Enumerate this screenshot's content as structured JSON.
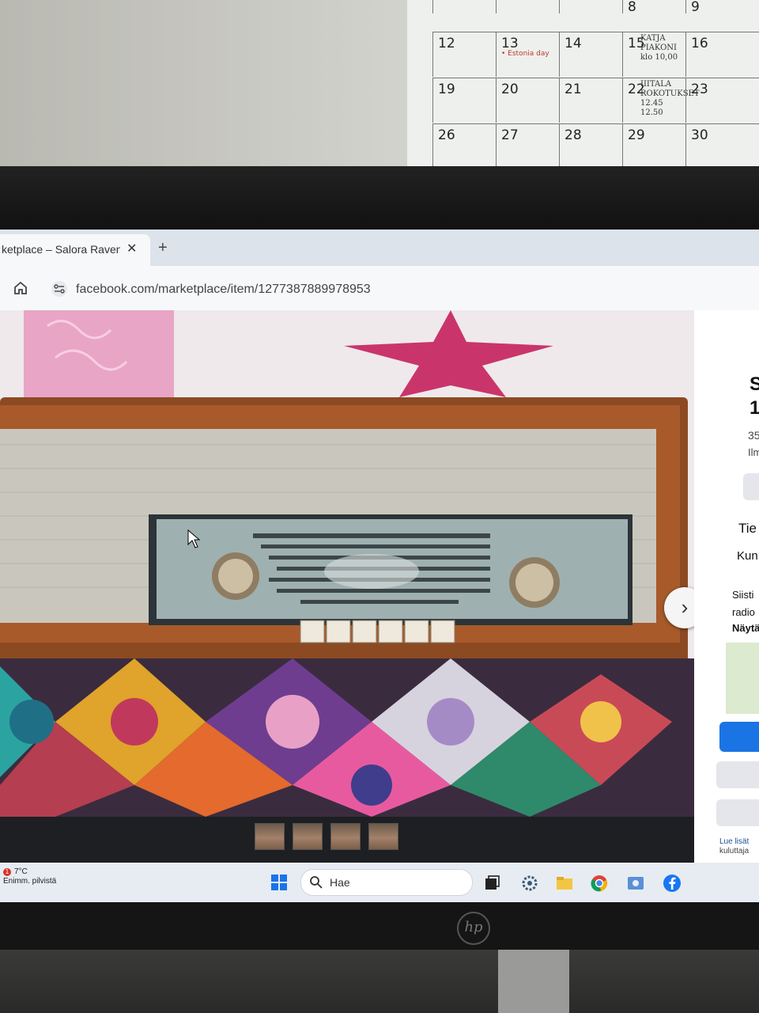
{
  "calendar": {
    "header_row": [
      "",
      "8",
      "9"
    ],
    "rows": [
      [
        {
          "n": "12"
        },
        {
          "n": "13",
          "note": "• Estonia day"
        },
        {
          "n": "14"
        },
        {
          "n": "15",
          "hand": "KATJA\nPIAKONI\nklo 10,00"
        },
        {
          "n": "16"
        }
      ],
      [
        {
          "n": "19"
        },
        {
          "n": "20"
        },
        {
          "n": "21"
        },
        {
          "n": "22",
          "hand": "IIITALA\nROKOTUKSET\n12.45\n12.50"
        },
        {
          "n": "23"
        }
      ],
      [
        {
          "n": "26"
        },
        {
          "n": "27"
        },
        {
          "n": "28"
        },
        {
          "n": "29"
        },
        {
          "n": "30"
        }
      ]
    ]
  },
  "browser": {
    "tab_title": "ketplace – Salora Raven",
    "url": "facebook.com/marketplace/item/1277387889978953"
  },
  "side_panel": {
    "title_fragment_1": "S",
    "title_fragment_2": "1",
    "price_fragment": "35",
    "listed_fragment": "Ilm",
    "section_details": "Tie",
    "condition": "Kun",
    "desc_1": "Siisti",
    "desc_2": "radio",
    "show_more": "Näytä",
    "footer_1": "Lue lisät",
    "footer_2": "kuluttaja"
  },
  "taskbar": {
    "weather_temp": "7°C",
    "weather_desc": "Enimm. pilvistä",
    "weather_badge": "1",
    "search_placeholder": "Hae"
  },
  "colors": {
    "facebook_blue": "#1b74e4",
    "taskbar_bg": "#e7ecf2"
  }
}
